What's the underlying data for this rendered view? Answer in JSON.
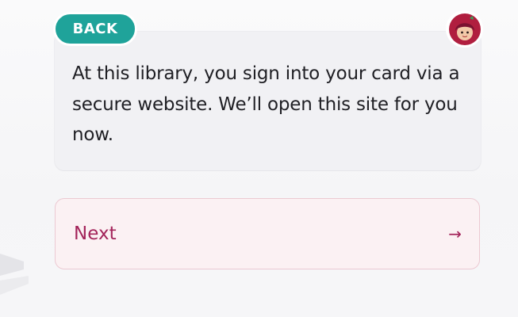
{
  "back_button": {
    "label": "BACK"
  },
  "card": {
    "message": "At this library, you sign into your card via a secure website. We’ll open this site for you now."
  },
  "next_button": {
    "label": "Next",
    "arrow": "→"
  },
  "colors": {
    "back_teal": "#1fa39a",
    "next_text": "#a3245a",
    "next_bg": "#fbf1f3",
    "avatar_red": "#b01e3f"
  },
  "icons": {
    "avatar": "libby-avatar-icon",
    "arrow": "arrow-right-icon"
  }
}
